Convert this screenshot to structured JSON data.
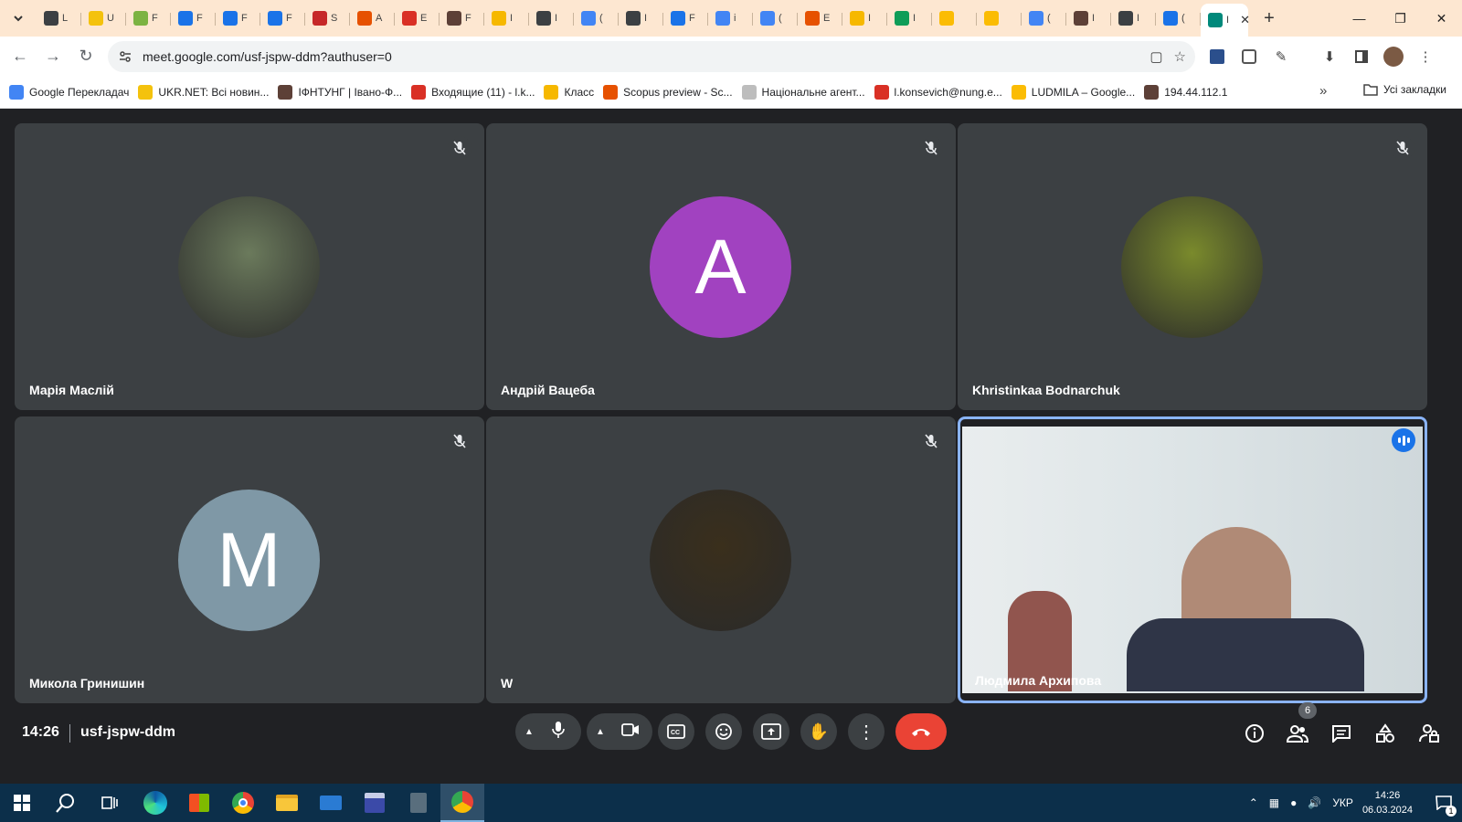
{
  "browser": {
    "tabs": [
      {
        "label": "L",
        "color": "#3c4043",
        "icon": "settings-icon"
      },
      {
        "label": "U",
        "color": "#f4c20d",
        "icon": "ukrnet-icon"
      },
      {
        "label": "F",
        "color": "#7cb342",
        "icon": "classroom-icon"
      },
      {
        "label": "F",
        "color": "#1a73e8",
        "icon": "doc-icon"
      },
      {
        "label": "F",
        "color": "#1a73e8",
        "icon": "doc-icon"
      },
      {
        "label": "F",
        "color": "#1a73e8",
        "icon": "doc-icon"
      },
      {
        "label": "S",
        "color": "#c62828",
        "icon": "thermometer-icon"
      },
      {
        "label": "A",
        "color": "#e65100",
        "icon": "ers-icon"
      },
      {
        "label": "E",
        "color": "#d93025",
        "icon": "gmail-icon"
      },
      {
        "label": "F",
        "color": "#5d4037",
        "icon": "gear-shield-icon"
      },
      {
        "label": "I",
        "color": "#f6b800",
        "icon": "classroom-icon"
      },
      {
        "label": "I",
        "color": "#3c4043",
        "icon": "settings-icon"
      },
      {
        "label": "(",
        "color": "#4285f4",
        "icon": "translate-icon"
      },
      {
        "label": "I",
        "color": "#3c4043",
        "icon": "settings-icon"
      },
      {
        "label": "F",
        "color": "#1a73e8",
        "icon": "form-icon"
      },
      {
        "label": "i",
        "color": "#4285f4",
        "icon": "google-icon"
      },
      {
        "label": "(",
        "color": "#4285f4",
        "icon": "translate-icon"
      },
      {
        "label": "E",
        "color": "#e65100",
        "icon": "profile-icon"
      },
      {
        "label": "I",
        "color": "#f6b800",
        "icon": "classroom-icon"
      },
      {
        "label": "I",
        "color": "#0f9d58",
        "icon": "sheets-icon"
      },
      {
        "label": "",
        "color": "#fbbc04",
        "icon": "drive-icon"
      },
      {
        "label": "",
        "color": "#fbbc04",
        "icon": "drive-icon"
      },
      {
        "label": "(",
        "color": "#4285f4",
        "icon": "translate-icon"
      },
      {
        "label": "I",
        "color": "#5d4037",
        "icon": "coat-of-arms-icon"
      },
      {
        "label": "I",
        "color": "#3c4043",
        "icon": "settings-icon"
      },
      {
        "label": "(",
        "color": "#1a73e8",
        "icon": "calendar-icon"
      },
      {
        "label": "I",
        "color": "#00897b",
        "icon": "meet-icon",
        "active": true
      }
    ],
    "url": "meet.google.com/usf-jspw-ddm?authuser=0",
    "bookmarks": [
      {
        "label": "Google Перекладач",
        "color": "#4285f4"
      },
      {
        "label": "UKR.NET: Всі новин...",
        "color": "#f4c20d"
      },
      {
        "label": "ІФНТУНГ | Івано-Ф...",
        "color": "#5d4037"
      },
      {
        "label": "Входящие (11) - l.k...",
        "color": "#d93025"
      },
      {
        "label": "Класс",
        "color": "#f6b800"
      },
      {
        "label": "Scopus preview - Sc...",
        "color": "#e65100"
      },
      {
        "label": "Національне агент...",
        "color": "#bdbdbd"
      },
      {
        "label": "l.konsevich@nung.e...",
        "color": "#d93025"
      },
      {
        "label": "LUDMILA – Google...",
        "color": "#fbbc04"
      },
      {
        "label": "194.44.112.1",
        "color": "#5d4037"
      }
    ],
    "all_bookmarks": "Усі закладки"
  },
  "meet": {
    "participants": [
      {
        "name": "Марія Маслій",
        "avatar_type": "photo",
        "avatar_bg": "#6b7a5c",
        "muted": true
      },
      {
        "name": "Андрій Вацеба",
        "avatar_type": "letter",
        "letter": "A",
        "avatar_bg": "#a142c0",
        "muted": true
      },
      {
        "name": "Khristinkaa Bodnarchuk",
        "avatar_type": "photo",
        "avatar_bg": "#7a8a2c",
        "muted": true
      },
      {
        "name": "Микола Гринишин",
        "avatar_type": "letter",
        "letter": "M",
        "avatar_bg": "#7f98a6",
        "muted": true
      },
      {
        "name": "W",
        "avatar_type": "photo",
        "avatar_bg": "#3a2f1c",
        "muted": true
      },
      {
        "name": "Людмила Архипова",
        "avatar_type": "video",
        "muted": false,
        "speaking": true
      }
    ],
    "time": "14:26",
    "meeting_code": "usf-jspw-ddm",
    "people_count": "6"
  },
  "taskbar": {
    "lang": "УКР",
    "time": "14:26",
    "date": "06.03.2024",
    "notifications": "1"
  }
}
